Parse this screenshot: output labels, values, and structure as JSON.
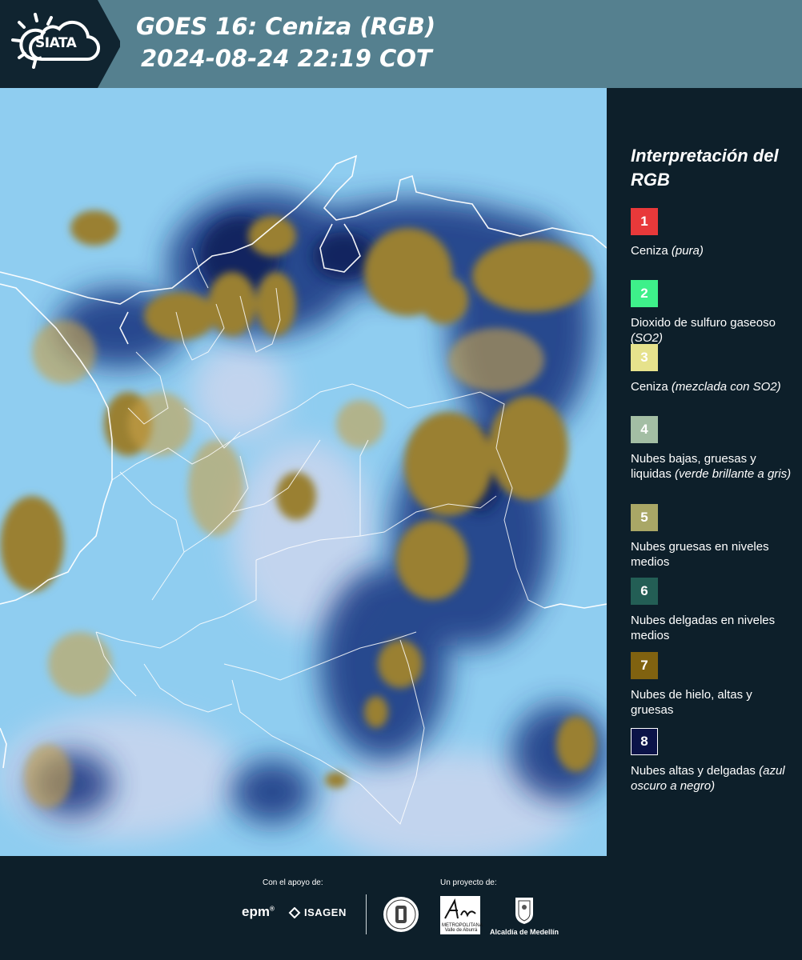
{
  "header": {
    "logo_text": "SIATA",
    "title": "GOES 16: Ceniza (RGB)",
    "subtitle": "2024-08-24 22:19 COT"
  },
  "legend": {
    "title": "Interpretación del RGB",
    "items": [
      {
        "number": "1",
        "label": "Ceniza",
        "note": "(pura)",
        "color": "#e8393a"
      },
      {
        "number": "2",
        "label": "Dioxido de sulfuro gaseoso",
        "note": "(SO2)",
        "color": "#3ef08a"
      },
      {
        "number": "3",
        "label": "Ceniza",
        "note": "(mezclada con SO2)",
        "color": "#e6e28c"
      },
      {
        "number": "4",
        "label": "Nubes bajas, gruesas y liquidas",
        "note": "(verde brillante a gris)",
        "color": "#a3bea4"
      },
      {
        "number": "5",
        "label": "Nubes gruesas en niveles medios",
        "note": "",
        "color": "#a9a766"
      },
      {
        "number": "6",
        "label": "Nubes delgadas en niveles medios",
        "note": "",
        "color": "#235e55"
      },
      {
        "number": "7",
        "label": "Nubes de hielo, altas y gruesas",
        "note": "",
        "color": "#806210"
      },
      {
        "number": "8",
        "label": "Nubes altas y delgadas",
        "note": "(azul oscuro a negro)",
        "color": "#0b1348"
      }
    ]
  },
  "footer": {
    "support_label": "Con el apoyo de:",
    "project_label": "Un proyecto de:",
    "sponsor_1": "epm",
    "sponsor_2": "ISAGEN",
    "partner_area": "Área",
    "partner_area_sub": "METROPOLITANA Valle de Aburrá",
    "partner_alcaldia": "Alcaldía de Medellín"
  },
  "colors": {
    "header_bg": "#55808f",
    "panel_bg": "#0d1f2a",
    "sky_blue": "#8ecdf0",
    "ice_cloud": "#9a8030",
    "deep_blue": "#0d2570"
  }
}
